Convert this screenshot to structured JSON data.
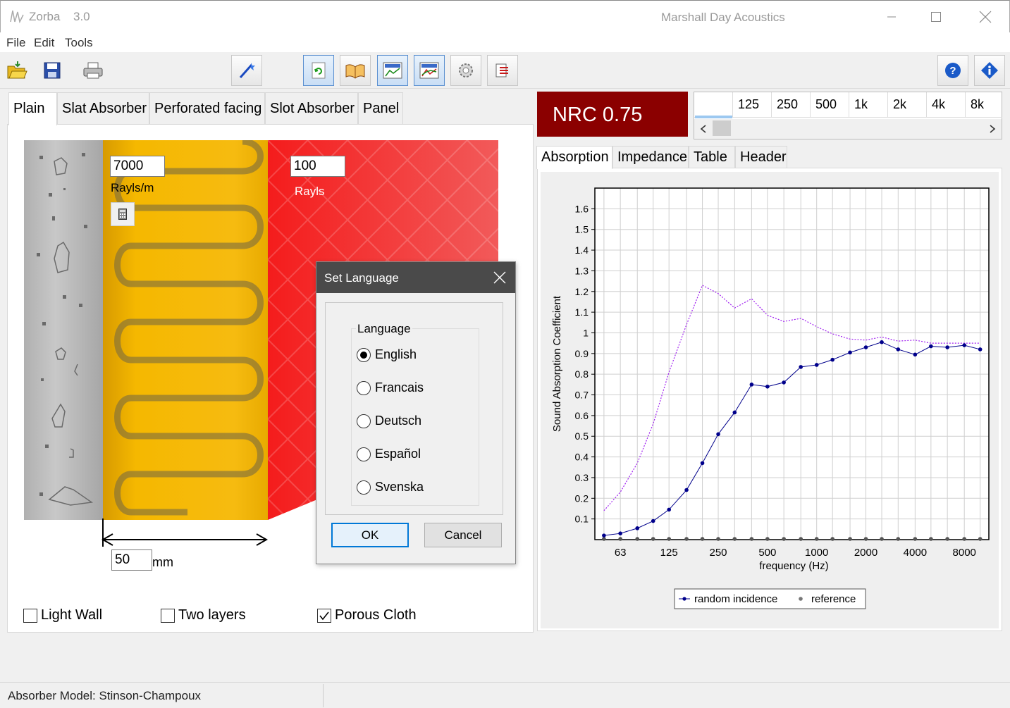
{
  "window": {
    "app_name": "Zorba",
    "version": "3.0",
    "company": "Marshall Day Acoustics"
  },
  "menu": [
    "File",
    "Edit",
    "Tools"
  ],
  "toolbar": {
    "icons": [
      "open-folder-icon",
      "save-disk-icon",
      "printer-icon",
      "calculate-wand-icon",
      "refresh-icon",
      "book-icon",
      "chart-view-icon",
      "chart-compare-icon",
      "settings-gear-icon",
      "export-icon",
      "help-icon",
      "about-info-icon"
    ]
  },
  "left_tabs": [
    "Plain",
    "Slat Absorber",
    "Perforated facing",
    "Slot Absorber",
    "Panel"
  ],
  "diagram": {
    "flow_resistivity": "7000",
    "flow_unit": "Rayls/m",
    "cloth_resistance": "100",
    "cloth_unit": "Rayls",
    "thickness": "50",
    "thickness_unit": "mm"
  },
  "options": {
    "light_wall": {
      "label": "Light Wall",
      "checked": false
    },
    "two_layers": {
      "label": "Two layers",
      "checked": false
    },
    "porous_cloth": {
      "label": "Porous Cloth",
      "checked": true
    }
  },
  "dialog": {
    "title": "Set Language",
    "group_label": "Language",
    "options": [
      "English",
      "Francais",
      "Deutsch",
      "Español",
      "Svenska"
    ],
    "selected": "English",
    "ok": "OK",
    "cancel": "Cancel"
  },
  "nrc": "NRC 0.75",
  "bands": [
    "125",
    "250",
    "500",
    "1k",
    "2k",
    "4k",
    "8k"
  ],
  "right_tabs": [
    "Absorption",
    "Impedance",
    "Table",
    "Header"
  ],
  "status": "Absorber Model:  Stinson-Champoux",
  "colors": {
    "nrc_bg": "#8b0000",
    "series_random": "#00008b",
    "series_reference": "#a020f0"
  },
  "chart_data": {
    "type": "line",
    "xlabel": "frequency (Hz)",
    "ylabel": "Sound Absorption Coefficient",
    "x_scale": "log",
    "x_tick_labels": [
      "63",
      "125",
      "250",
      "500",
      "1000",
      "2000",
      "4000",
      "8000"
    ],
    "y_tick_labels": [
      "0.1",
      "0.2",
      "0.3",
      "0.4",
      "0.5",
      "0.6",
      "0.7",
      "0.8",
      "0.9",
      "1",
      "1.1",
      "1.2",
      "1.3",
      "1.4",
      "1.5",
      "1.6"
    ],
    "ylim": [
      0,
      1.7
    ],
    "grid": true,
    "legend_position": "bottom-center",
    "x": [
      50,
      63,
      80,
      100,
      125,
      160,
      200,
      250,
      315,
      400,
      500,
      630,
      800,
      1000,
      1250,
      1600,
      2000,
      2500,
      3150,
      4000,
      5000,
      6300,
      8000,
      10000
    ],
    "series": [
      {
        "name": "random incidence",
        "style": "solid-markers",
        "values": [
          0.02,
          0.03,
          0.055,
          0.09,
          0.145,
          0.24,
          0.37,
          0.51,
          0.615,
          0.75,
          0.74,
          0.76,
          0.835,
          0.845,
          0.87,
          0.905,
          0.93,
          0.955,
          0.92,
          0.895,
          0.935,
          0.93,
          0.94,
          0.92
        ]
      },
      {
        "name": "reference",
        "style": "gray-markers",
        "values": [
          0,
          0,
          0,
          0,
          0,
          0,
          0,
          0,
          0,
          0,
          0,
          0,
          0,
          0,
          0,
          0,
          0,
          0,
          0,
          0,
          0,
          0,
          0,
          0
        ]
      },
      {
        "style": "dashed",
        "values": [
          0.14,
          0.23,
          0.37,
          0.56,
          0.81,
          1.04,
          1.23,
          1.19,
          1.12,
          1.165,
          1.085,
          1.055,
          1.07,
          1.03,
          0.995,
          0.97,
          0.965,
          0.98,
          0.96,
          0.965,
          0.95,
          0.95,
          0.95,
          0.95
        ]
      }
    ]
  }
}
